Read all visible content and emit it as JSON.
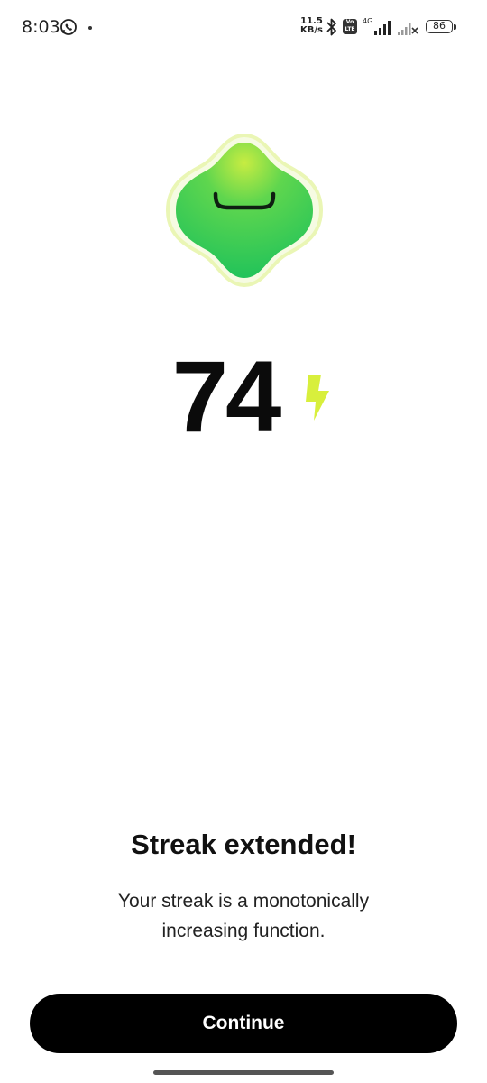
{
  "status_bar": {
    "time": "8:03",
    "net_speed_value": "11.5",
    "net_speed_unit": "KB/s",
    "volte_label": "Vo LTE",
    "network_type": "4G",
    "battery_level": "86"
  },
  "streak": {
    "count": "74",
    "bolt_color": "#d8ef3c"
  },
  "mascot": {
    "body_color": "#2ecc5a",
    "glow_color": "#d6f58a"
  },
  "message": {
    "title": "Streak extended!",
    "subtitle": "Your streak is a monotonically increasing function."
  },
  "actions": {
    "continue_label": "Continue"
  }
}
